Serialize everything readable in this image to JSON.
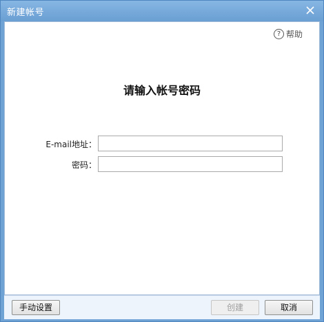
{
  "window": {
    "title": "新建帐号"
  },
  "help": {
    "label": "帮助",
    "icon": "?"
  },
  "form": {
    "heading": "请输入帐号密码",
    "email_label": "E-mail地址：",
    "email_value": "",
    "password_label": "密码：",
    "password_value": ""
  },
  "buttons": {
    "manual_settings": "手动设置",
    "create": "创建",
    "cancel": "取消"
  },
  "colors": {
    "titlebar": "#7aaedd",
    "bottombar": "#eef4fb",
    "disabled_text": "#9d9d9d"
  }
}
